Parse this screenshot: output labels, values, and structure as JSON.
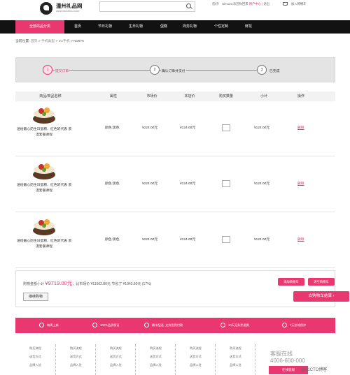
{
  "header": {
    "logo_title": "潼州礼品网",
    "logo_sub": "www.tianzhou.com",
    "search_placeholder": "",
    "welcome": "您好！ wim123,欢迎你回来",
    "user_center": "用户中心",
    "logout": "退出",
    "cart": "加入购物车"
  },
  "nav": {
    "all_label": "全部商品分类",
    "items": [
      "首页",
      "节日礼物",
      "生日礼物",
      "蛋糕",
      "商务礼物",
      "个性定制",
      "鲜花"
    ]
  },
  "breadcrumb": {
    "prefix": "当前位置:",
    "items": [
      "首页",
      "手机类型",
      "3G手机",
      "KD876"
    ]
  },
  "steps": [
    {
      "num": "1",
      "label": "提交订单",
      "active": true
    },
    {
      "num": "2",
      "label": "确认订单并支付",
      "active": false
    },
    {
      "num": "3",
      "label": "已完成",
      "active": false
    }
  ],
  "table": {
    "headers": [
      "商品/商品名称",
      "属性",
      "市场价",
      "本店价",
      "购买数量",
      "小计",
      "操作"
    ],
    "rows": [
      {
        "name": "送给最心的生日蛋糕、红色的代表 浪漫套餐课程",
        "attr": "颜色:黑色",
        "market": "¥224.00元",
        "price": "¥124.00元",
        "subtotal": "¥124.00元",
        "op": "删除"
      },
      {
        "name": "送给最心的生日蛋糕、红色的代表 浪漫套餐课程",
        "attr": "颜色:黑色",
        "market": "¥224.00元",
        "price": "¥124.00元",
        "subtotal": "¥124.00元",
        "op": "删除"
      },
      {
        "name": "送给最心的生日蛋糕、红色的代表 浪漫套餐课程",
        "attr": "颜色:黑色",
        "market": "¥224.00元",
        "price": "¥124.00元",
        "subtotal": "¥124.00元",
        "op": "删除"
      }
    ]
  },
  "summary": {
    "label": "购物金额小计",
    "total": "¥9719.00元",
    "detail": "，比市场价 ¥11662.80元 节省了 ¥1943.80元 (17%)",
    "add_cart": "添加购物车",
    "clear_cart": "清空购物车",
    "continue": "继续购物",
    "checkout": "去购物车结算"
  },
  "services": [
    "每周上新",
    "100%品质保证",
    "最丰配送, 支持货到付款",
    "10天无条件退换",
    "7天价格保护"
  ],
  "footer": {
    "columns": [
      [
        "购买流程",
        "送货方式",
        "品牌入驻"
      ],
      [
        "购买流程",
        "送货方式",
        "品牌入驻"
      ],
      [
        "购买流程",
        "送货方式",
        "品牌入驻"
      ],
      [
        "购买流程",
        "送货方式",
        "品牌入驻"
      ],
      [
        "购买流程",
        "送货方式",
        "品牌入驻"
      ],
      [
        "购买流程",
        "送货方式",
        "品牌入驻"
      ]
    ],
    "service_title": "客服在线",
    "phone": "4006-600-000",
    "online": "在线客服"
  },
  "watermark": "@51CTO博客",
  "colors": {
    "accent": "#e8386f",
    "nav_bg": "#121212"
  }
}
